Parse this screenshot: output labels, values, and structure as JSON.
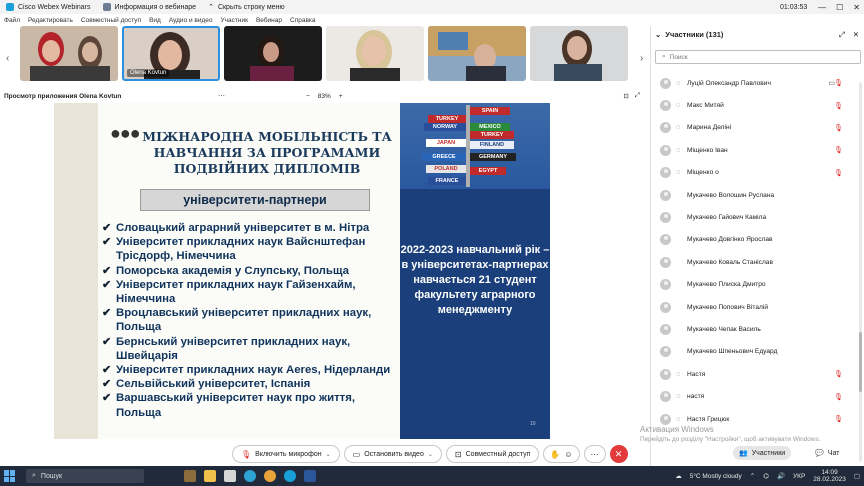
{
  "titlebar": {
    "tabs": [
      "Cisco Webex Webinars",
      "Информация о вебинаре",
      "Скрыть строку меню"
    ],
    "timer": "01:03:53"
  },
  "menubar": [
    "Файл",
    "Редактировать",
    "Совместный доступ",
    "Вид",
    "Аудио и видео",
    "Участник",
    "Вебинар",
    "Справка"
  ],
  "thumbnails": [
    {
      "label": ""
    },
    {
      "label": "Olena Kovtun"
    },
    {
      "label": ""
    },
    {
      "label": ""
    },
    {
      "label": ""
    },
    {
      "label": ""
    }
  ],
  "viewer": {
    "title": "Просмотр приложения Olena Kovtun",
    "zoom": "83%",
    "zoom_minus": "−",
    "zoom_plus": "+"
  },
  "slide": {
    "title": "МІЖНАРОДНА МОБІЛЬНІСТЬ ТА НАВЧАННЯ ЗА ПРОГРАМАМИ ПОДВІЙНИХ ДИПЛОМІВ",
    "subtitle": "університети-партнери",
    "universities": [
      "Словацький аграрний університет в м. Нітра",
      "Університет прикладних наук  Вайснштефан Трісдорф, Німеччина",
      "Поморська академія у Слупську, Польща",
      "Університет прикладних наук  Гайзенхайм, Німеччина",
      "Вроцлавський університет прикладних наук, Польща",
      "Бернський університет прикладних наук, Швейцарія",
      "Університет прикладних наук Aeres, Нідерланди",
      "Сельвійський університет, Іспанія",
      "Варшавський університет наук про життя, Польща"
    ],
    "right_text": "2022-2023 навчальний рік – в університетах-партнерах навчається 21 студент факультету аграрного менеджменту",
    "signs": [
      "SPAIN",
      "TURKEY",
      "NORWAY",
      "MEXICO",
      "TURKEY",
      "JAPAN",
      "FINLAND",
      "GREECE",
      "GERMANY",
      "POLAND",
      "EGYPT",
      "FRANCE"
    ],
    "page_number": "10"
  },
  "controls": {
    "mic": "Включить микрофон",
    "video": "Остановить видео",
    "share": "Совместный доступ"
  },
  "participants": {
    "header": "Участники (131)",
    "search_placeholder": "Поиск",
    "list": [
      {
        "name": "Луцій Олександр Павлович",
        "audio": true,
        "cam": true
      },
      {
        "name": "Макс Митяй",
        "audio": true,
        "cam": false
      },
      {
        "name": "Марина Деліні",
        "audio": true,
        "cam": false
      },
      {
        "name": "Міщенко Іван",
        "audio": true,
        "cam": false
      },
      {
        "name": "Міщенко о",
        "audio": true,
        "cam": false
      },
      {
        "name": "Мукачево Волошин Руслана",
        "audio": false,
        "cam": false
      },
      {
        "name": "Мукачево Гайович Каміла",
        "audio": false,
        "cam": false
      },
      {
        "name": "Мукачево Довгінко Ярослав",
        "audio": false,
        "cam": false
      },
      {
        "name": "Мукачево Коваль Станіслав",
        "audio": false,
        "cam": false
      },
      {
        "name": "Мукачево Плиска Дмитро",
        "audio": false,
        "cam": false
      },
      {
        "name": "Мукачево Попович Віталій",
        "audio": false,
        "cam": false
      },
      {
        "name": "Мукачево Чепак Василь",
        "audio": false,
        "cam": false
      },
      {
        "name": "Мукачево Шпеньович Едуард",
        "audio": false,
        "cam": false
      },
      {
        "name": "Настя",
        "audio": true,
        "cam": false
      },
      {
        "name": "настя",
        "audio": true,
        "cam": false
      },
      {
        "name": "Настя Грицюк",
        "audio": true,
        "cam": false
      }
    ],
    "participants_btn": "Участники",
    "chat_btn": "Чат"
  },
  "activation": {
    "line1": "Активация Windows",
    "line2": "Перейдіть до розділу \"Настройки\", щоб активувати Windows."
  },
  "taskbar": {
    "search": "Пошук",
    "weather": "5°C  Mostly cloudy",
    "lang": "УКР",
    "time": "14:09",
    "date": "28.02.2023"
  }
}
